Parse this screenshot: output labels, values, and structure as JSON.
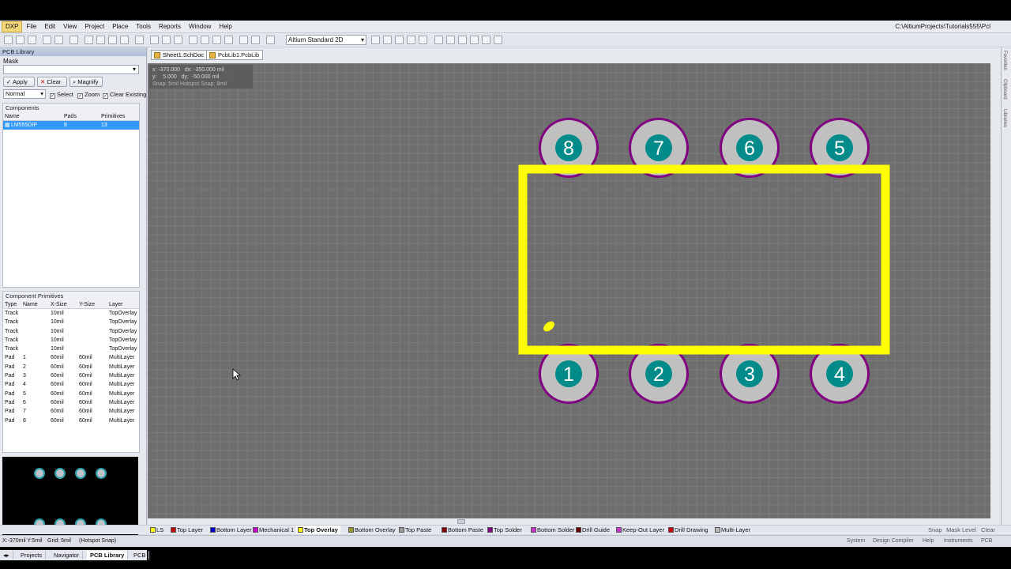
{
  "menu": {
    "items": [
      "DXP",
      "File",
      "Edit",
      "View",
      "Project",
      "Place",
      "Tools",
      "Reports",
      "Window",
      "Help"
    ],
    "path": "C:\\AltiumProjects\\Tutorials555\\Pcl"
  },
  "toolbar": {
    "view_select": "Altium Standard 2D"
  },
  "panel": {
    "title": "PCB Library",
    "mask_label": "Mask",
    "apply_label": "Apply",
    "clear_label": "Clear",
    "magnify_label": "Magnify",
    "mode_value": "Normal",
    "select_label": "Select",
    "zoom_label": "Zoom",
    "clear_existing_label": "Clear Existing"
  },
  "components": {
    "title": "Components",
    "headers": [
      "Name",
      "Pads",
      "Primitives"
    ],
    "rows": [
      {
        "name": "LM555DIP",
        "pads": "8",
        "primitives": "13"
      }
    ]
  },
  "primitives": {
    "title": "Component Primitives",
    "headers": [
      "Type",
      "Name",
      "X-Size",
      "Y-Size",
      "Layer"
    ],
    "rows": [
      [
        "Track",
        "",
        "10mil",
        "",
        "TopOverlay"
      ],
      [
        "Track",
        "",
        "10mil",
        "",
        "TopOverlay"
      ],
      [
        "Track",
        "",
        "10mil",
        "",
        "TopOverlay"
      ],
      [
        "Track",
        "",
        "10mil",
        "",
        "TopOverlay"
      ],
      [
        "Track",
        "",
        "10mil",
        "",
        "TopOverlay"
      ],
      [
        "Pad",
        "1",
        "60mil",
        "60mil",
        "MultiLayer"
      ],
      [
        "Pad",
        "2",
        "60mil",
        "60mil",
        "MultiLayer"
      ],
      [
        "Pad",
        "3",
        "60mil",
        "60mil",
        "MultiLayer"
      ],
      [
        "Pad",
        "4",
        "60mil",
        "60mil",
        "MultiLayer"
      ],
      [
        "Pad",
        "5",
        "60mil",
        "60mil",
        "MultiLayer"
      ],
      [
        "Pad",
        "6",
        "60mil",
        "60mil",
        "MultiLayer"
      ],
      [
        "Pad",
        "7",
        "60mil",
        "60mil",
        "MultiLayer"
      ],
      [
        "Pad",
        "8",
        "60mil",
        "60mil",
        "MultiLayer"
      ]
    ]
  },
  "doc_tabs": [
    "Sheet1.SchDoc",
    "PcbLib1.PcbLib"
  ],
  "coords": {
    "line1": "x: -370.000   dx: -350.000 mil",
    "line2": "y:    5.000   dy:  -50.000 mil",
    "line3": "Snap: 5mil Hotspot Snap: 8mil"
  },
  "pads_top": [
    "8",
    "7",
    "6",
    "5"
  ],
  "pads_bottom": [
    "1",
    "2",
    "3",
    "4"
  ],
  "colors": {
    "silkscreen": "#ffff00",
    "pad_ring": "#800080",
    "pad_fill": "#c0c0c0",
    "hole": "#008b8b"
  },
  "panel_tabs": [
    "Projects",
    "Navigator",
    "PCB Library",
    "PCB"
  ],
  "layer_tabs": [
    {
      "label": "LS",
      "color": "#ffff00"
    },
    {
      "label": "Top Layer",
      "color": "#cc0000"
    },
    {
      "label": "Bottom Layer",
      "color": "#0000cc"
    },
    {
      "label": "Mechanical 1",
      "color": "#cc00cc"
    },
    {
      "label": "Top Overlay",
      "color": "#ffff00"
    },
    {
      "label": "Bottom Overlay",
      "color": "#999933"
    },
    {
      "label": "Top Paste",
      "color": "#999999"
    },
    {
      "label": "Bottom Paste",
      "color": "#880000"
    },
    {
      "label": "Top Solder",
      "color": "#880088"
    },
    {
      "label": "Bottom Solder",
      "color": "#cc33cc"
    },
    {
      "label": "Drill Guide",
      "color": "#660000"
    },
    {
      "label": "Keep-Out Layer",
      "color": "#cc33cc"
    },
    {
      "label": "Drill Drawing",
      "color": "#cc0000"
    },
    {
      "label": "Multi-Layer",
      "color": "#bbbbbb"
    }
  ],
  "right_labels": [
    "Snap",
    "Mask Level",
    "Clear"
  ],
  "status": {
    "coord": "X:-370mil Y:5mil",
    "grid": "Grid: 5mil",
    "snap": "(Hotspot Snap)",
    "right": [
      "System",
      "Design Compiler",
      "Help",
      "Instruments",
      "PCB"
    ]
  },
  "side_strip": [
    "Favorites",
    "Clipboard",
    "Libraries"
  ]
}
